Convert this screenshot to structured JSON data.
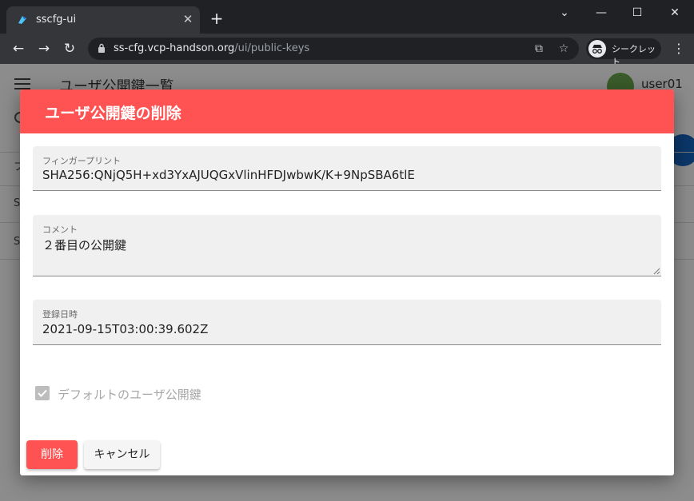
{
  "browser": {
    "tab_title": "sscfg-ui",
    "url_host": "ss-cfg.vcp-handson.org",
    "url_path": "/ui/public-keys",
    "incognito_label": "シークレット"
  },
  "page": {
    "title": "ユーザ公開鍵一覧",
    "username": "user01",
    "row_cells": [
      "フ",
      "S",
      "S"
    ]
  },
  "dialog": {
    "title": "ユーザ公開鍵の削除",
    "fingerprint": {
      "label": "フィンガープリント",
      "value": "SHA256:QNjQ5H+xd3YxAJUQGxVlinHFDJwbwK/K+9NpSBA6tlE"
    },
    "comment": {
      "label": "コメント",
      "value": "２番目の公開鍵"
    },
    "registered": {
      "label": "登録日時",
      "value": "2021-09-15T03:00:39.602Z"
    },
    "default_checkbox": {
      "label": "デフォルトのユーザ公開鍵",
      "checked": true,
      "disabled": true
    },
    "delete_button": "削除",
    "cancel_button": "キャンセル"
  },
  "colors": {
    "accent": "#ff5252",
    "browser_dark": "#202124",
    "browser_toolbar": "#35363a"
  },
  "icons": [
    "back-arrow-icon",
    "forward-arrow-icon",
    "reload-icon",
    "lock-icon",
    "translate-icon",
    "star-icon",
    "incognito-icon",
    "more-menu-icon",
    "close-icon",
    "new-tab-icon",
    "minimize-icon",
    "maximize-icon",
    "window-close-icon",
    "tab-search-icon",
    "hamburger-icon",
    "search-icon",
    "check-icon"
  ]
}
